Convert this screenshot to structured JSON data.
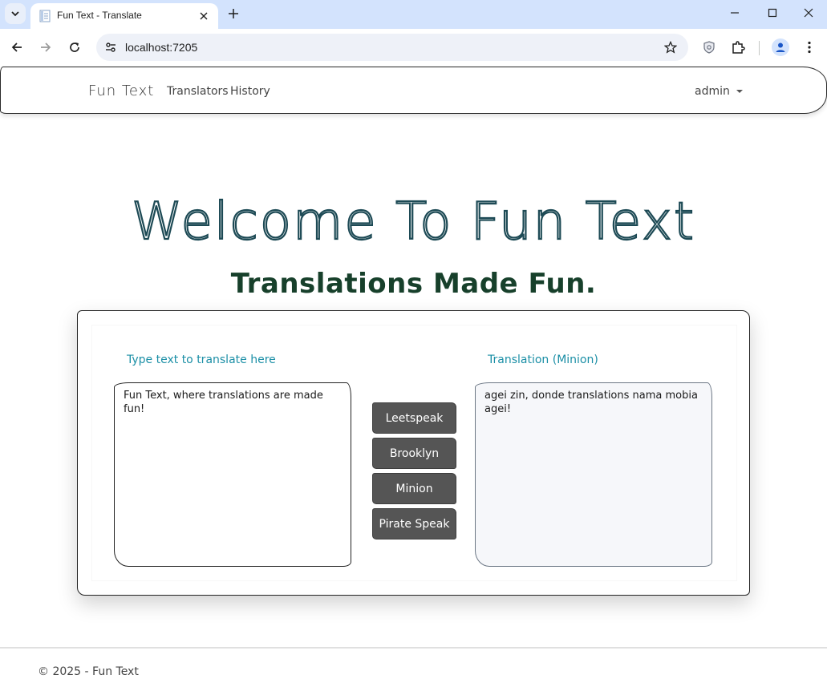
{
  "browser": {
    "tab_title": "Fun Text - Translate",
    "url": "localhost:7205"
  },
  "navbar": {
    "brand": "Fun Text",
    "links": [
      "Translators",
      "History"
    ],
    "user": "admin"
  },
  "hero": {
    "title": "Welcome To Fun Text",
    "subtitle": "Translations Made Fun."
  },
  "translator": {
    "input_label": "Type text to translate here",
    "input_value": "Fun Text, where translations are made fun!",
    "output_label": "Translation (Minion)",
    "output_value": "agei zin, donde translations nama mobia agei!",
    "buttons": [
      "Leetspeak",
      "Brooklyn",
      "Minion",
      "Pirate Speak"
    ]
  },
  "footer": {
    "text": "© 2025 - Fun Text"
  },
  "colors": {
    "accent_label": "#1b8fa6",
    "button_bg": "#555555",
    "hero_outline": "#1d4a55",
    "subtitle": "#17402b",
    "tabstrip": "#d3e3fd"
  }
}
